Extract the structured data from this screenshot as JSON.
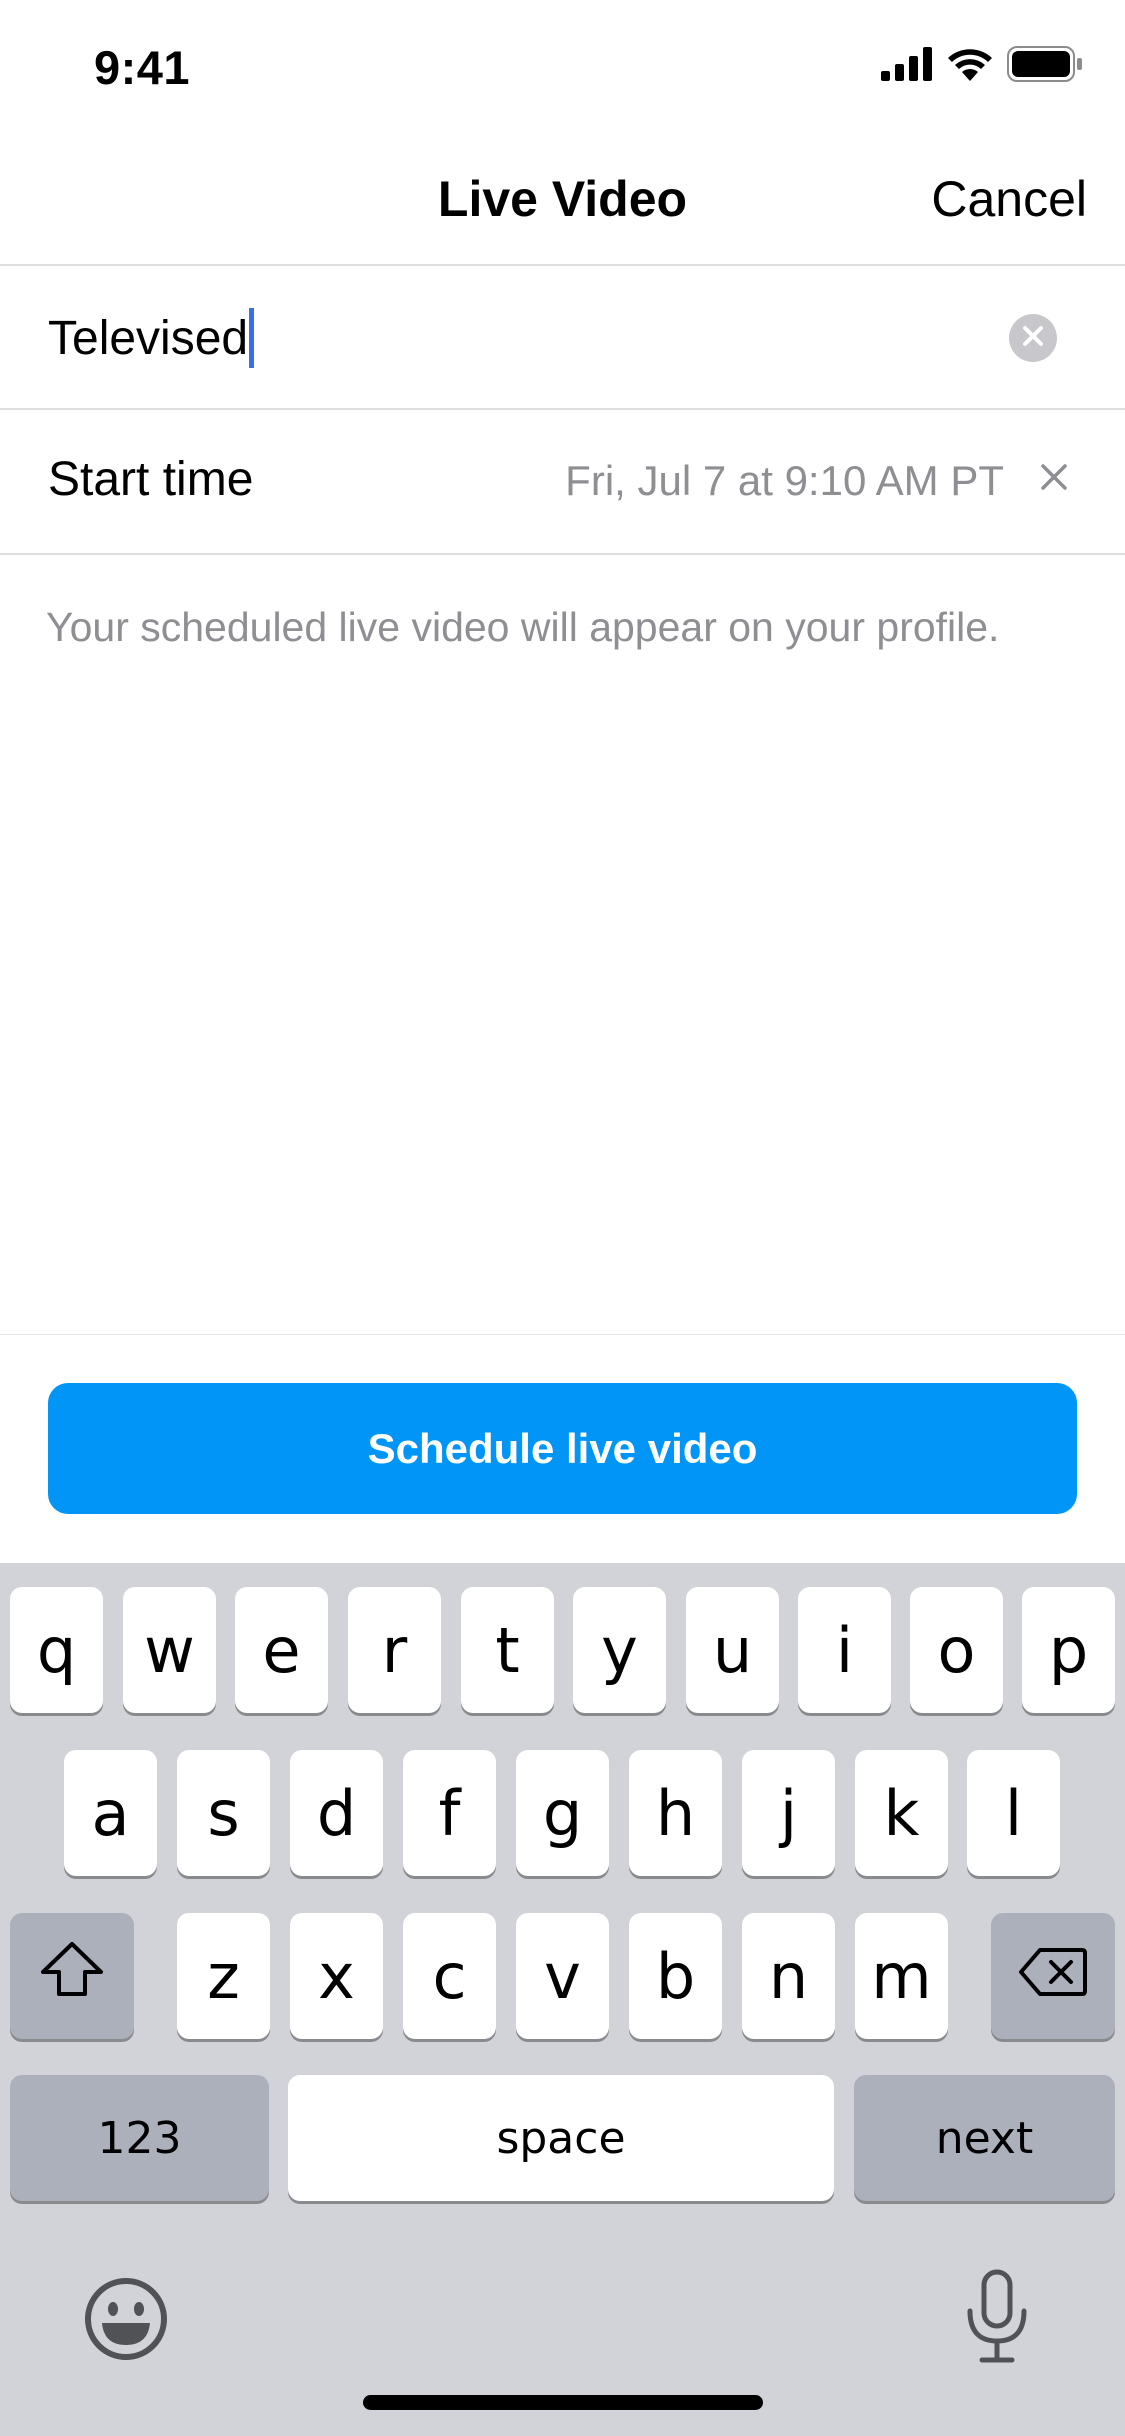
{
  "status_bar": {
    "time": "9:41"
  },
  "nav": {
    "title": "Live Video",
    "cancel_label": "Cancel"
  },
  "form": {
    "title_value": "Televised",
    "start_time_label": "Start time",
    "start_time_value": "Fri, Jul 7 at 9:10 AM PT",
    "hint": "Your scheduled live video will appear on your profile."
  },
  "actions": {
    "schedule_label": "Schedule live video"
  },
  "keyboard": {
    "row1": [
      "q",
      "w",
      "e",
      "r",
      "t",
      "y",
      "u",
      "i",
      "o",
      "p"
    ],
    "row2": [
      "a",
      "s",
      "d",
      "f",
      "g",
      "h",
      "j",
      "k",
      "l"
    ],
    "row3": [
      "z",
      "x",
      "c",
      "v",
      "b",
      "n",
      "m"
    ],
    "numbers_label": "123",
    "space_label": "space",
    "next_label": "next"
  },
  "icons": {
    "signal": "cellular-signal-icon",
    "wifi": "wifi-icon",
    "battery": "battery-icon",
    "clear": "clear-circle-icon",
    "close": "close-icon",
    "shift": "shift-icon",
    "backspace": "backspace-icon",
    "emoji": "emoji-icon",
    "microphone": "microphone-icon"
  },
  "colors": {
    "accent": "#0095f6",
    "caret": "#3b6ee8",
    "secondary_text": "#8e8e93",
    "keyboard_bg": "#d1d3d9",
    "function_key": "#abb0ba"
  }
}
